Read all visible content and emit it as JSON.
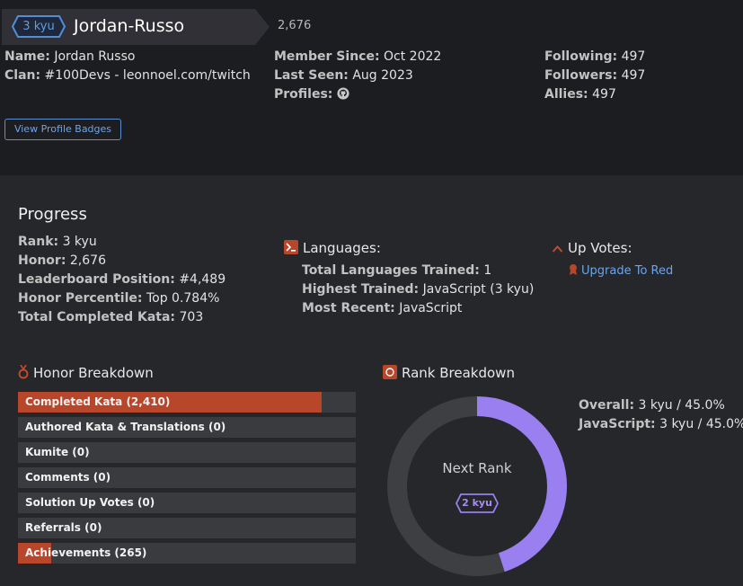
{
  "profile": {
    "rank": "3 kyu",
    "username": "Jordan-Russo",
    "honor": "2,676",
    "name_label": "Name:",
    "name": "Jordan Russo",
    "clan_label": "Clan:",
    "clan": "#100Devs - leonnoel.com/twitch",
    "member_since_label": "Member Since:",
    "member_since": "Oct 2022",
    "last_seen_label": "Last Seen:",
    "last_seen": "Aug 2023",
    "profiles_label": "Profiles:",
    "profiles_icon": "github-icon",
    "following_label": "Following:",
    "following": "497",
    "followers_label": "Followers:",
    "followers": "497",
    "allies_label": "Allies:",
    "allies": "497",
    "badges_button": "View Profile Badges"
  },
  "progress": {
    "title": "Progress",
    "rank_label": "Rank:",
    "rank": "3 kyu",
    "honor_label": "Honor:",
    "honor": "2,676",
    "leaderboard_label": "Leaderboard Position:",
    "leaderboard": "#4,489",
    "percentile_label": "Honor Percentile:",
    "percentile": "Top 0.784%",
    "kata_label": "Total Completed Kata:",
    "kata": "703"
  },
  "languages": {
    "title": "Languages:",
    "total_label": "Total Languages Trained:",
    "total": "1",
    "highest_label": "Highest Trained:",
    "highest": "JavaScript (3 kyu)",
    "recent_label": "Most Recent:",
    "recent": "JavaScript"
  },
  "upvotes": {
    "title": "Up Votes:",
    "link": "Upgrade To Red"
  },
  "honor_breakdown": {
    "title": "Honor Breakdown",
    "bars": [
      {
        "label": "Completed Kata (2,410)",
        "fraction": 0.9
      },
      {
        "label": "Authored Kata & Translations (0)",
        "fraction": 0
      },
      {
        "label": "Kumite (0)",
        "fraction": 0
      },
      {
        "label": "Comments (0)",
        "fraction": 0
      },
      {
        "label": "Solution Up Votes (0)",
        "fraction": 0
      },
      {
        "label": "Referrals (0)",
        "fraction": 0
      },
      {
        "label": "Achievements (265)",
        "fraction": 0.099
      }
    ]
  },
  "rank_breakdown": {
    "title": "Rank Breakdown",
    "next_rank_label": "Next Rank",
    "next_rank": "2 kyu",
    "progress_fraction": 0.45,
    "overall_label": "Overall:",
    "overall": "3 kyu / 45.0%",
    "javascript_label": "JavaScript:",
    "javascript": "3 kyu / 45.0%"
  },
  "colors": {
    "background": "#1c1d21",
    "panel": "#26272b",
    "bar_track": "#3a3b3f",
    "bar_fill": "#b7462b",
    "accent_blue": "#5b9fe4",
    "rank_purple": "#9a7ff0",
    "donut_track": "#3e3f43"
  }
}
